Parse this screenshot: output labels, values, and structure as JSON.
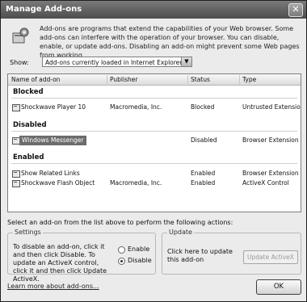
{
  "window": {
    "title": "Manage Add-ons",
    "close_glyph": "✕"
  },
  "intro": "Add-ons are programs that extend the capabilities of your Web browser. Some add-ons can interfere with the operation of your browser. You can disable, enable, or update add-ons. Disabling an add-on might prevent some Web pages from working.",
  "show": {
    "label": "Show:",
    "value": "Add-ons currently loaded in Internet Explorer"
  },
  "list": {
    "columns": [
      "Name of add-on",
      "Publisher",
      "Status",
      "Type"
    ],
    "groups": [
      {
        "label": "Blocked",
        "rows": [
          {
            "name": "Shockwave Player 10",
            "publisher": "Macromedia, Inc.",
            "status": "Blocked",
            "type": "Untrusted Extension"
          }
        ]
      },
      {
        "label": "Disabled",
        "rows": [
          {
            "name": "Windows Messenger",
            "publisher": "",
            "status": "Disabled",
            "type": "Browser Extension",
            "selected": true
          }
        ]
      },
      {
        "label": "Enabled",
        "rows": [
          {
            "name": "Show Related Links",
            "publisher": "",
            "status": "Enabled",
            "type": "Browser Extension"
          },
          {
            "name": "Shockwave Flash Object",
            "publisher": "Macromedia, Inc.",
            "status": "Enabled",
            "type": "ActiveX Control"
          }
        ]
      }
    ]
  },
  "action_text": "Select an add-on from the list above to perform the following actions:",
  "settings": {
    "legend": "Settings",
    "text": "To disable an add-on, click it and then click Disable. To update an ActiveX control, click it and then click Update ActiveX.",
    "enable_label": "Enable",
    "disable_label": "Disable",
    "selected": "Disable"
  },
  "update": {
    "legend": "Update",
    "text": "Click here to update this add-on",
    "button_label": "Update ActiveX"
  },
  "footer": {
    "learn_link": "Learn more about add-ons...",
    "ok_label": "OK"
  },
  "icons": {
    "header": "addons-gear-icon",
    "row": "addon-icon"
  }
}
